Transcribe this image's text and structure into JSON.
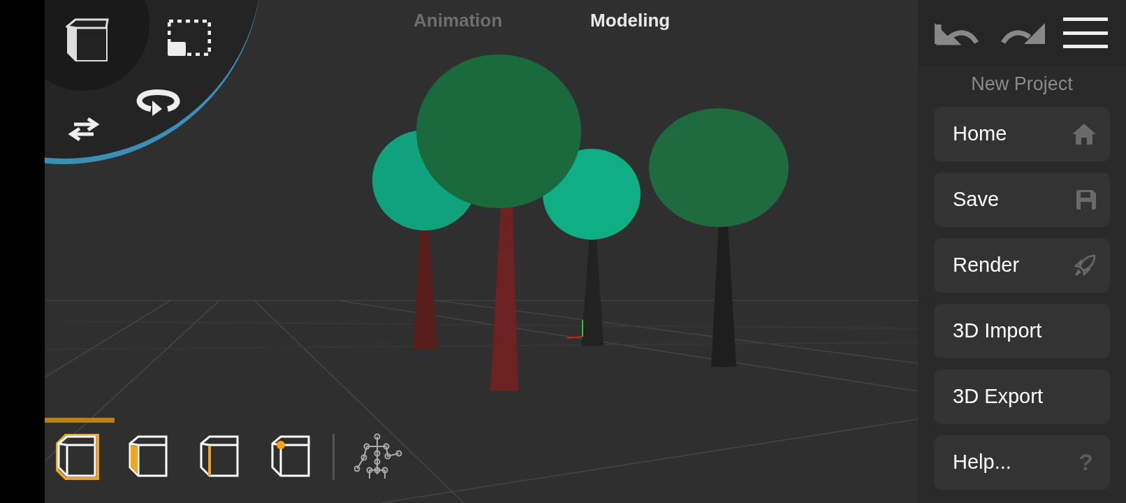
{
  "top_tabs": [
    {
      "label": "Animation",
      "selected": false
    },
    {
      "label": "Modeling",
      "selected": true
    }
  ],
  "project_title": "New Project",
  "menu": [
    {
      "label": "Home",
      "kind": "home"
    },
    {
      "label": "Save",
      "kind": "save"
    },
    {
      "label": "Render",
      "kind": "render"
    },
    {
      "label": "3D Import",
      "kind": "plain"
    },
    {
      "label": "3D Export",
      "kind": "plain"
    },
    {
      "label": "Help...",
      "kind": "help",
      "icon_text": "?"
    }
  ],
  "selection_modes": [
    {
      "kind": "object",
      "selected": true
    },
    {
      "kind": "face",
      "selected": false
    },
    {
      "kind": "edge",
      "selected": false
    },
    {
      "kind": "vertex",
      "selected": false
    }
  ]
}
